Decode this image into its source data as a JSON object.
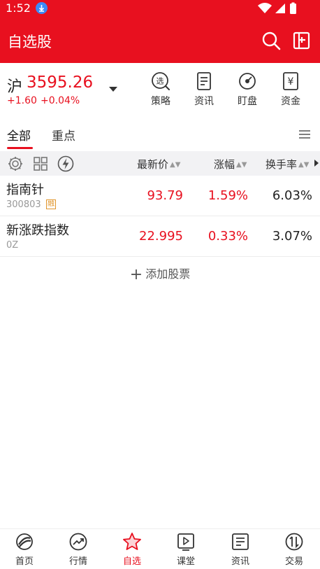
{
  "status_bar": {
    "time": "1:52"
  },
  "app_bar": {
    "title": "自选股",
    "icons": [
      "search-icon",
      "switch-icon"
    ]
  },
  "index_quote": {
    "name": "沪",
    "value": "3595.26",
    "change": "+1.60",
    "change_pct": "+0.04%",
    "tools": [
      {
        "label": "策略",
        "icon": "strategy-icon",
        "glyph": "选"
      },
      {
        "label": "资讯",
        "icon": "news-icon"
      },
      {
        "label": "盯盘",
        "icon": "watch-icon"
      },
      {
        "label": "资金",
        "icon": "fund-icon",
        "glyph": "¥"
      }
    ]
  },
  "tabs": [
    {
      "label": "全部",
      "active": true
    },
    {
      "label": "重点",
      "active": false
    }
  ],
  "columns": {
    "latest_price": "最新价",
    "change_pct": "涨幅",
    "turnover": "换手率"
  },
  "stocks": [
    {
      "name": "指南针",
      "code": "300803",
      "tag": "融",
      "price": "93.79",
      "change_pct": "1.59%",
      "turnover": "6.03%"
    },
    {
      "name": "新涨跌指数",
      "code": "0Z",
      "tag": "",
      "price": "22.995",
      "change_pct": "0.33%",
      "turnover": "3.07%"
    }
  ],
  "add_stock": {
    "plus": "+",
    "label": "添加股票"
  },
  "bottom_nav": [
    {
      "label": "首页",
      "icon": "home-icon",
      "active": false
    },
    {
      "label": "行情",
      "icon": "market-icon",
      "active": false
    },
    {
      "label": "自选",
      "icon": "star-icon",
      "active": true
    },
    {
      "label": "课堂",
      "icon": "classroom-icon",
      "active": false
    },
    {
      "label": "资讯",
      "icon": "news-icon",
      "active": false
    },
    {
      "label": "交易",
      "icon": "trade-icon",
      "active": false
    }
  ],
  "colors": {
    "brand_red": "#e8101f",
    "up_red": "#e8101f",
    "tag_orange": "#e0952b",
    "header_bg": "#f2f2f4"
  }
}
